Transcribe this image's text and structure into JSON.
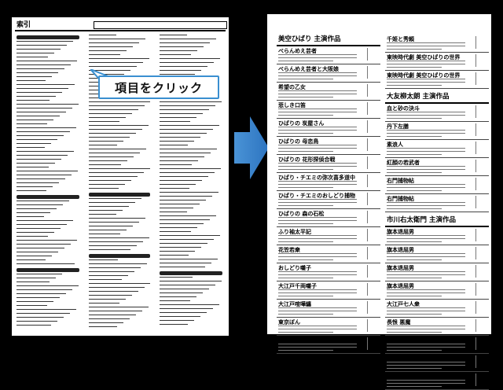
{
  "index_page": {
    "title": "索引"
  },
  "callout": {
    "text": "項目をクリック"
  },
  "works_page": {
    "left_column": {
      "section_title": "美空ひばり 主演作品",
      "entries": [
        "べらんめえ芸者",
        "べらんめえ芸者と大阪娘",
        "希望の乙女",
        "悲しき口笛",
        "ひばりの 炭屋さん",
        "ひばりの 母恋鳥",
        "ひばりの 花形探偵合戦",
        "ひばり・チエミの弥次喜多道中",
        "ひばり・チエミのおしどり捕物",
        "ひばりの 森の石松",
        "ふり袖太平記",
        "花笠若衆",
        "おしどり囃子",
        "大江戸千両囃子",
        "大江戸喧嘩纏",
        "東京ぼん",
        "お嬢吉三"
      ]
    },
    "right_column": {
      "sections": [
        {
          "title": "",
          "entries": [
            "千姫と秀頼",
            "東映時代劇 美空ひばりの世界",
            "東映時代劇 美空ひばりの世界"
          ]
        },
        {
          "title": "大友柳太朗 主演作品",
          "entries": [
            "血と砂の決斗",
            "丹下左膳",
            "素浪人",
            "紅顔の若武者",
            "右門捕物帖",
            "右門捕物帖"
          ]
        },
        {
          "title": "市川右太衛門 主演作品",
          "entries": [
            "旗本退屈男",
            "旗本退屈男",
            "旗本退屈男",
            "旗本退屈男",
            "大江戸七人衆",
            "長恨 悪魔",
            "旗本退屈男",
            "天保六花撰",
            "血斗水滸伝"
          ]
        }
      ]
    }
  }
}
